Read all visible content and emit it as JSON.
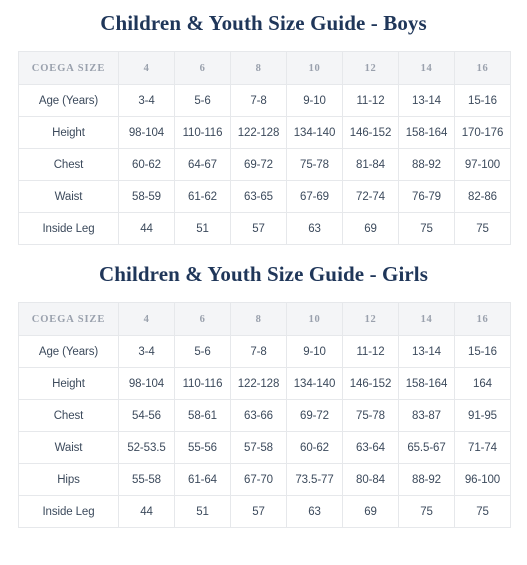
{
  "boys": {
    "title": "Children & Youth Size Guide - Boys",
    "header": {
      "label": "COEGA SIZE",
      "sizes": [
        "4",
        "6",
        "8",
        "10",
        "12",
        "14",
        "16"
      ]
    },
    "rows": [
      {
        "label": "Age (Years)",
        "values": [
          "3-4",
          "5-6",
          "7-8",
          "9-10",
          "11-12",
          "13-14",
          "15-16"
        ]
      },
      {
        "label": "Height",
        "values": [
          "98-104",
          "110-116",
          "122-128",
          "134-140",
          "146-152",
          "158-164",
          "170-176"
        ]
      },
      {
        "label": "Chest",
        "values": [
          "60-62",
          "64-67",
          "69-72",
          "75-78",
          "81-84",
          "88-92",
          "97-100"
        ]
      },
      {
        "label": "Waist",
        "values": [
          "58-59",
          "61-62",
          "63-65",
          "67-69",
          "72-74",
          "76-79",
          "82-86"
        ]
      },
      {
        "label": "Inside Leg",
        "values": [
          "44",
          "51",
          "57",
          "63",
          "69",
          "75",
          "75"
        ]
      }
    ]
  },
  "girls": {
    "title": "Children & Youth Size Guide - Girls",
    "header": {
      "label": "COEGA SIZE",
      "sizes": [
        "4",
        "6",
        "8",
        "10",
        "12",
        "14",
        "16"
      ]
    },
    "rows": [
      {
        "label": "Age (Years)",
        "values": [
          "3-4",
          "5-6",
          "7-8",
          "9-10",
          "11-12",
          "13-14",
          "15-16"
        ]
      },
      {
        "label": "Height",
        "values": [
          "98-104",
          "110-116",
          "122-128",
          "134-140",
          "146-152",
          "158-164",
          "164"
        ]
      },
      {
        "label": "Chest",
        "values": [
          "54-56",
          "58-61",
          "63-66",
          "69-72",
          "75-78",
          "83-87",
          "91-95"
        ]
      },
      {
        "label": "Waist",
        "values": [
          "52-53.5",
          "55-56",
          "57-58",
          "60-62",
          "63-64",
          "65.5-67",
          "71-74"
        ]
      },
      {
        "label": "Hips",
        "values": [
          "55-58",
          "61-64",
          "67-70",
          "73.5-77",
          "80-84",
          "88-92",
          "96-100"
        ]
      },
      {
        "label": "Inside Leg",
        "values": [
          "44",
          "51",
          "57",
          "63",
          "69",
          "75",
          "75"
        ]
      }
    ]
  },
  "colors": {
    "title": "#1f3659",
    "header_background": "#f4f5f7",
    "header_text": "#9aa1ad",
    "body_text": "#3c4a5c",
    "border": "#e6e8eb"
  }
}
